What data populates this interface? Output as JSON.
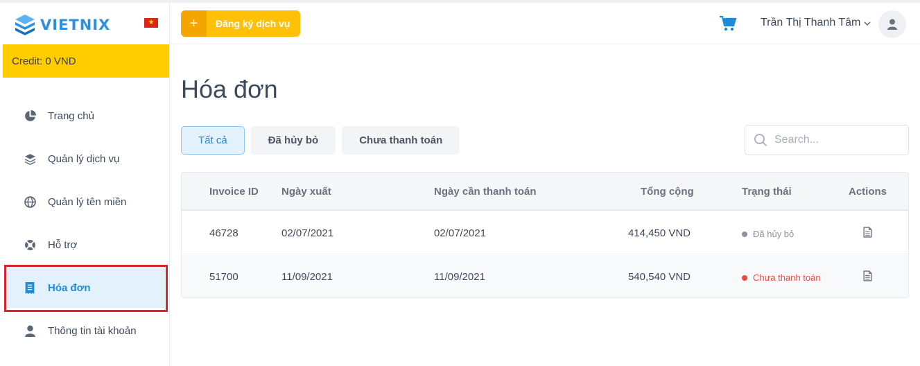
{
  "brand": {
    "name": "VIETNIX"
  },
  "sidebar": {
    "credit": "Credit: 0 VND",
    "items": [
      {
        "label": "Trang chủ",
        "icon": "pie-chart-icon"
      },
      {
        "label": "Quản lý dịch vụ",
        "icon": "layers-icon"
      },
      {
        "label": "Quản lý tên miền",
        "icon": "globe-icon"
      },
      {
        "label": "Hỗ trợ",
        "icon": "life-ring-icon"
      },
      {
        "label": "Hóa đơn",
        "icon": "receipt-icon",
        "active": true
      },
      {
        "label": "Thông tin tài khoản",
        "icon": "user-icon"
      }
    ]
  },
  "header": {
    "register_label": "Đăng ký dịch vụ",
    "user_name": "Trần Thị Thanh Tâm"
  },
  "main": {
    "title": "Hóa đơn",
    "tabs": [
      {
        "label": "Tất cả",
        "active": true
      },
      {
        "label": "Đã hủy bỏ"
      },
      {
        "label": "Chưa thanh toán"
      }
    ],
    "search_placeholder": "Search..."
  },
  "table": {
    "columns": [
      "Invoice ID",
      "Ngày xuất",
      "Ngày cần thanh toán",
      "Tổng cộng",
      "Trạng thái",
      "Actions"
    ],
    "rows": [
      {
        "id": "46728",
        "issued": "02/07/2021",
        "due": "02/07/2021",
        "total": "414,450 VND",
        "status": "Đã hủy bỏ"
      },
      {
        "id": "51700",
        "issued": "11/09/2021",
        "due": "11/09/2021",
        "total": "540,540 VND",
        "status": "Chưa thanh toán"
      }
    ]
  },
  "colors": {
    "accent": "#1f8ad6",
    "brand_yellow": "#ffc107",
    "credit_bg": "#ffcc00",
    "highlight_border": "#d9232d",
    "unpaid": "#e74c3c"
  }
}
